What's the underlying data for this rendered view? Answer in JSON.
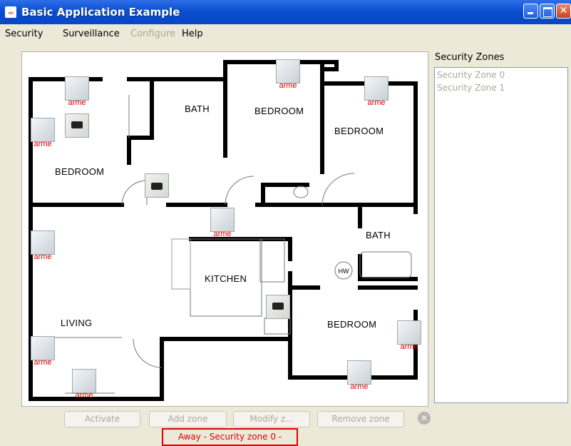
{
  "window": {
    "title": "Basic Application Example",
    "app_icon": "java-cup-icon"
  },
  "menu": {
    "items": [
      {
        "label": "Security",
        "enabled": true
      },
      {
        "label": "Surveillance",
        "enabled": true
      },
      {
        "label": "Configure",
        "enabled": false
      },
      {
        "label": "Help",
        "enabled": true
      }
    ]
  },
  "floorplan": {
    "rooms": [
      "BEDROOM",
      "BATH",
      "BEDROOM",
      "BEDROOM",
      "BATH",
      "KITCHEN",
      "LIVING",
      "BEDROOM"
    ],
    "fixture_label": "HW",
    "sensor_label": "arme",
    "devices": [
      {
        "kind": "sensor",
        "state": "arme"
      },
      {
        "kind": "sensor",
        "state": "arme"
      },
      {
        "kind": "sensor",
        "state": "arme"
      },
      {
        "kind": "sensor",
        "state": "arme"
      },
      {
        "kind": "sensor",
        "state": "arme"
      },
      {
        "kind": "sensor",
        "state": "arme"
      },
      {
        "kind": "sensor",
        "state": "arme"
      },
      {
        "kind": "sensor",
        "state": "arme"
      },
      {
        "kind": "sensor",
        "state": "arme"
      },
      {
        "kind": "sensor",
        "state": "arme"
      },
      {
        "kind": "camera"
      },
      {
        "kind": "camera"
      },
      {
        "kind": "camera"
      }
    ]
  },
  "zones": {
    "title": "Security Zones",
    "items": [
      "Security Zone 0",
      "Security Zone 1"
    ]
  },
  "buttons": {
    "activate": "Activate",
    "add_zone": "Add zone",
    "modify_zone": "Modify z...",
    "remove_zone": "Remove zone"
  },
  "status": {
    "text": "Away - Security zone 0 -",
    "color": "#e00000"
  },
  "colors": {
    "title_bar": "#0a4fcf",
    "alert": "#e10000",
    "disabled_text": "#aca899"
  }
}
